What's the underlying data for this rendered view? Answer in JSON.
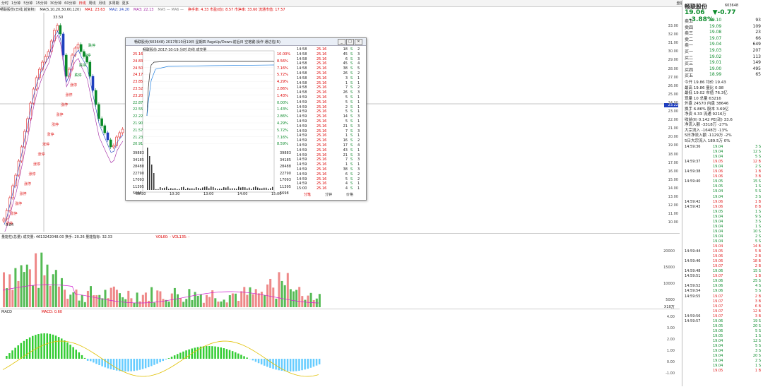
{
  "toolbar": {
    "periods": [
      "分时",
      "1分钟",
      "5分钟",
      "15分钟",
      "30分钟",
      "60分钟",
      "日线",
      "周线",
      "月线",
      "多周期",
      "更多"
    ],
    "active_period": "日线",
    "right_menu": [
      "盘前",
      "盘后",
      "统计",
      "画线",
      "F10",
      "标记",
      "+自选",
      "返回"
    ]
  },
  "info_line": {
    "stock": "畅联股份(日线,前复权)",
    "ma_params": "MA(5,10,20,30,60,120)",
    "ma1": "MA1: 23.63",
    "ma2": "MA2: 24.20",
    "ma3": "MA3: 22.13",
    "extra": "MA5 — MA6 —",
    "indicators": "换手率: 4.33  市盈(动): 8.57  市净率: 33.60  流通市值: 17.57"
  },
  "price_pane": {
    "high_label": "33.50",
    "low_label": "8.84",
    "y_labels": [
      "33.00",
      "32.00",
      "31.00",
      "30.00",
      "29.00",
      "28.00",
      "27.00",
      "26.00",
      "25.00",
      "24.00",
      "23.00",
      "22.00",
      "21.00",
      "20.00",
      "19.00",
      "18.00",
      "17.00",
      "16.00",
      "15.00",
      "14.00",
      "13.00",
      "12.00",
      "11.00",
      "10.00"
    ],
    "cursor_price": "23.22",
    "markers": [
      "涨停",
      "涨停",
      "涨停",
      "涨停",
      "涨停",
      "涨停",
      "涨停",
      "涨停",
      "涨停",
      "涨停",
      "涨停",
      "涨停",
      "涨停",
      "涨停",
      "涨停",
      "跌停",
      "跌停",
      "跌停",
      "跌停"
    ]
  },
  "volume_pane": {
    "label": "量能柱(总量)",
    "values": "成交量: 4613242048.00  换手: 20.26  量能指标: 32.33",
    "legend": "VOL60: -  VOL135: -",
    "y_labels": [
      "20000",
      "15000",
      "10000",
      "5000"
    ],
    "unit": "X10万"
  },
  "macd_pane": {
    "label": "MACD",
    "legend": "MACD: 0.60",
    "y_labels": [
      "4.00",
      "3.00",
      "2.00",
      "1.00",
      "0.00",
      "-1.00"
    ]
  },
  "right_panel": {
    "name": "畅联股份",
    "code": "603648",
    "price": "19.06",
    "change": "▼-0.77",
    "pct": "-3.88%",
    "asks": [
      {
        "label": "卖五",
        "price": "19.10",
        "vol": "93"
      },
      {
        "label": "卖四",
        "price": "19.09",
        "vol": "109"
      },
      {
        "label": "卖三",
        "price": "19.08",
        "vol": "23"
      },
      {
        "label": "卖二",
        "price": "19.07",
        "vol": "66"
      },
      {
        "label": "卖一",
        "price": "19.04",
        "vol": "649"
      }
    ],
    "bids": [
      {
        "label": "买一",
        "price": "19.03",
        "vol": "207"
      },
      {
        "label": "买二",
        "price": "19.02",
        "vol": "113"
      },
      {
        "label": "买三",
        "price": "19.01",
        "vol": "149"
      },
      {
        "label": "买四",
        "price": "19.00",
        "vol": "495"
      },
      {
        "label": "买五",
        "price": "18.99",
        "vol": "65"
      }
    ],
    "stats": [
      "今开 19.86  均价 19.43",
      "最高 19.86  量比 0.98",
      "最低 19.02  市值 76.3亿",
      "现量 10  总量 63216",
      "外盘 24570  内盘 38646",
      "换手 6.86%  股本 3.69亿",
      "净资 4.33  流通 9216万",
      "收益(Ⅱ) 0.142  PE(动) 33.6",
      "净流入额 -3318万 -27%",
      "大宗流入 -1648万 -13%",
      "5日净流入额 -1129万 -2%",
      "5日大宗流入 189.5万 0%"
    ],
    "trades": [
      {
        "t": "14:59:36",
        "p": "19.04",
        "v": "3 S"
      },
      {
        "t": "",
        "p": "19.04",
        "v": "12 S"
      },
      {
        "t": "",
        "p": "19.04",
        "v": "5 S"
      },
      {
        "t": "14:59:37",
        "p": "19.05",
        "v": "12 B"
      },
      {
        "t": "",
        "p": "19.04",
        "v": "2 S"
      },
      {
        "t": "14:59:38",
        "p": "19.06",
        "v": "1 B"
      },
      {
        "t": "",
        "p": "19.06",
        "v": "3 B"
      },
      {
        "t": "14:59:40",
        "p": "19.05",
        "v": "15 S"
      },
      {
        "t": "",
        "p": "19.05",
        "v": "1 S"
      },
      {
        "t": "",
        "p": "19.04",
        "v": "5 S"
      },
      {
        "t": "",
        "p": "19.04",
        "v": "3 S"
      },
      {
        "t": "14:59:42",
        "p": "19.06",
        "v": "1 B"
      },
      {
        "t": "14:59:43",
        "p": "19.06",
        "v": "8 B"
      },
      {
        "t": "",
        "p": "19.05",
        "v": "1 S"
      },
      {
        "t": "",
        "p": "19.04",
        "v": "9 S"
      },
      {
        "t": "",
        "p": "19.04",
        "v": "3 S"
      },
      {
        "t": "",
        "p": "19.04",
        "v": "1 S"
      },
      {
        "t": "",
        "p": "19.04",
        "v": "10 S"
      },
      {
        "t": "",
        "p": "19.04",
        "v": "2 S"
      },
      {
        "t": "",
        "p": "19.04",
        "v": "5 S"
      },
      {
        "t": "",
        "p": "19.04",
        "v": "14 B"
      },
      {
        "t": "14:59:44",
        "p": "19.05",
        "v": "5 B"
      },
      {
        "t": "",
        "p": "19.06",
        "v": "2 B"
      },
      {
        "t": "14:59:46",
        "p": "19.06",
        "v": "18 B"
      },
      {
        "t": "",
        "p": "19.07",
        "v": "2 B"
      },
      {
        "t": "14:59:48",
        "p": "19.06",
        "v": "15 S"
      },
      {
        "t": "14:59:51",
        "p": "19.07",
        "v": "1 B"
      },
      {
        "t": "",
        "p": "19.06",
        "v": "25 S"
      },
      {
        "t": "14:59:52",
        "p": "19.06",
        "v": "4 S"
      },
      {
        "t": "14:59:54",
        "p": "19.06",
        "v": "5 S"
      },
      {
        "t": "14:59:55",
        "p": "19.07",
        "v": "2 B"
      },
      {
        "t": "",
        "p": "19.07",
        "v": "3 B"
      },
      {
        "t": "",
        "p": "19.07",
        "v": "6 B"
      },
      {
        "t": "",
        "p": "19.07",
        "v": "12 B"
      },
      {
        "t": "14:59:56",
        "p": "19.07",
        "v": "3 B"
      },
      {
        "t": "14:59:57",
        "p": "19.06",
        "v": "19 S"
      },
      {
        "t": "",
        "p": "19.05",
        "v": "20 S"
      },
      {
        "t": "",
        "p": "19.06",
        "v": "5 S"
      },
      {
        "t": "",
        "p": "19.05",
        "v": "1 S"
      },
      {
        "t": "",
        "p": "19.04",
        "v": "12 S"
      },
      {
        "t": "",
        "p": "19.04",
        "v": "5 S"
      },
      {
        "t": "",
        "p": "19.04",
        "v": "3 S"
      },
      {
        "t": "",
        "p": "19.04",
        "v": "20 S"
      },
      {
        "t": "",
        "p": "19.04",
        "v": "2 S"
      },
      {
        "t": "",
        "p": "19.04",
        "v": "1 S"
      },
      {
        "t": "",
        "p": "19.05",
        "v": "1 B"
      }
    ]
  },
  "popup": {
    "title": "畅联股份(603648) 2017年10月19日 星期四 PageUp/Down:前后日 空格键:操作 通达信(R)",
    "chart_title": "畅联股份  2017-10-19 分时 均线 成交量",
    "left_prices": [
      "25.16",
      "24.83",
      "24.50",
      "24.17",
      "23.85",
      "23.52",
      "23.20",
      "22.87",
      "22.55",
      "22.22",
      "21.90",
      "21.57",
      "21.23",
      "20.91"
    ],
    "right_pcts": [
      "10.00%",
      "8.56%",
      "7.16%",
      "5.72%",
      "4.29%",
      "2.86%",
      "1.43%",
      "0.00%",
      "1.43%",
      "2.86%",
      "4.29%",
      "5.72%",
      "7.16%",
      "8.59%"
    ],
    "vol_labels": [
      "39883",
      "34185",
      "28488",
      "22790",
      "17093",
      "11395",
      "5698"
    ],
    "time_labels": [
      "09:30",
      "10:30",
      "13:00",
      "14:00",
      "15:00"
    ],
    "ticks": [
      {
        "t": "14:58",
        "p": "25.16",
        "v": "18",
        "s": "S",
        "n": "2"
      },
      {
        "t": "14:58",
        "p": "25.16",
        "v": "45",
        "s": "S",
        "n": "3"
      },
      {
        "t": "14:58",
        "p": "25.16",
        "v": "6",
        "s": "S",
        "n": "3"
      },
      {
        "t": "14:58",
        "p": "25.16",
        "v": "45",
        "s": "S",
        "n": "4"
      },
      {
        "t": "14:58",
        "p": "25.16",
        "v": "38",
        "s": "S",
        "n": "5"
      },
      {
        "t": "14:58",
        "p": "25.16",
        "v": "26",
        "s": "S",
        "n": "2"
      },
      {
        "t": "14:58",
        "p": "25.16",
        "v": "3",
        "s": "S",
        "n": "1"
      },
      {
        "t": "14:58",
        "p": "25.16",
        "v": "1",
        "s": "S",
        "n": "1"
      },
      {
        "t": "14:58",
        "p": "25.16",
        "v": "7",
        "s": "S",
        "n": "2"
      },
      {
        "t": "14:58",
        "p": "25.16",
        "v": "26",
        "s": "S",
        "n": "3"
      },
      {
        "t": "14:59",
        "p": "25.16",
        "v": "5",
        "s": "S",
        "n": "1"
      },
      {
        "t": "14:59",
        "p": "25.16",
        "v": "5",
        "s": "S",
        "n": "1"
      },
      {
        "t": "14:59",
        "p": "25.16",
        "v": "2",
        "s": "S",
        "n": "1"
      },
      {
        "t": "14:59",
        "p": "25.16",
        "v": "5",
        "s": "S",
        "n": "1"
      },
      {
        "t": "14:59",
        "p": "25.16",
        "v": "14",
        "s": "S",
        "n": "3"
      },
      {
        "t": "14:59",
        "p": "25.16",
        "v": "5",
        "s": "S",
        "n": "1"
      },
      {
        "t": "14:59",
        "p": "25.16",
        "v": "21",
        "s": "S",
        "n": "3"
      },
      {
        "t": "14:59",
        "p": "25.16",
        "v": "7",
        "s": "S",
        "n": "3"
      },
      {
        "t": "14:59",
        "p": "25.16",
        "v": "1",
        "s": "S",
        "n": "1"
      },
      {
        "t": "14:59",
        "p": "25.16",
        "v": "16",
        "s": "S",
        "n": "2"
      },
      {
        "t": "14:59",
        "p": "25.16",
        "v": "17",
        "s": "S",
        "n": "4"
      },
      {
        "t": "14:59",
        "p": "25.16",
        "v": "43",
        "s": "S",
        "n": "1"
      },
      {
        "t": "14:59",
        "p": "25.16",
        "v": "21",
        "s": "S",
        "n": "3"
      },
      {
        "t": "14:59",
        "p": "25.16",
        "v": "7",
        "s": "S",
        "n": "3"
      },
      {
        "t": "14:59",
        "p": "25.16",
        "v": "1",
        "s": "S",
        "n": "1"
      },
      {
        "t": "14:59",
        "p": "25.16",
        "v": "38",
        "s": "S",
        "n": "3"
      },
      {
        "t": "14:59",
        "p": "25.16",
        "v": "6",
        "s": "S",
        "n": "2"
      },
      {
        "t": "14:59",
        "p": "25.16",
        "v": "5",
        "s": "S",
        "n": "2"
      },
      {
        "t": "14:59",
        "p": "25.16",
        "v": "4",
        "s": "S",
        "n": "1"
      },
      {
        "t": "15:00",
        "p": "25.16",
        "v": "4",
        "s": "S",
        "n": "1"
      }
    ],
    "tabs": [
      "分笔",
      "分钟",
      "价格"
    ],
    "close_label": "✕",
    "min_label": "_",
    "max_label": "□"
  },
  "colors": {
    "up": "#e02020",
    "down": "#0a8a2a",
    "accent": "#1f3fbf"
  }
}
